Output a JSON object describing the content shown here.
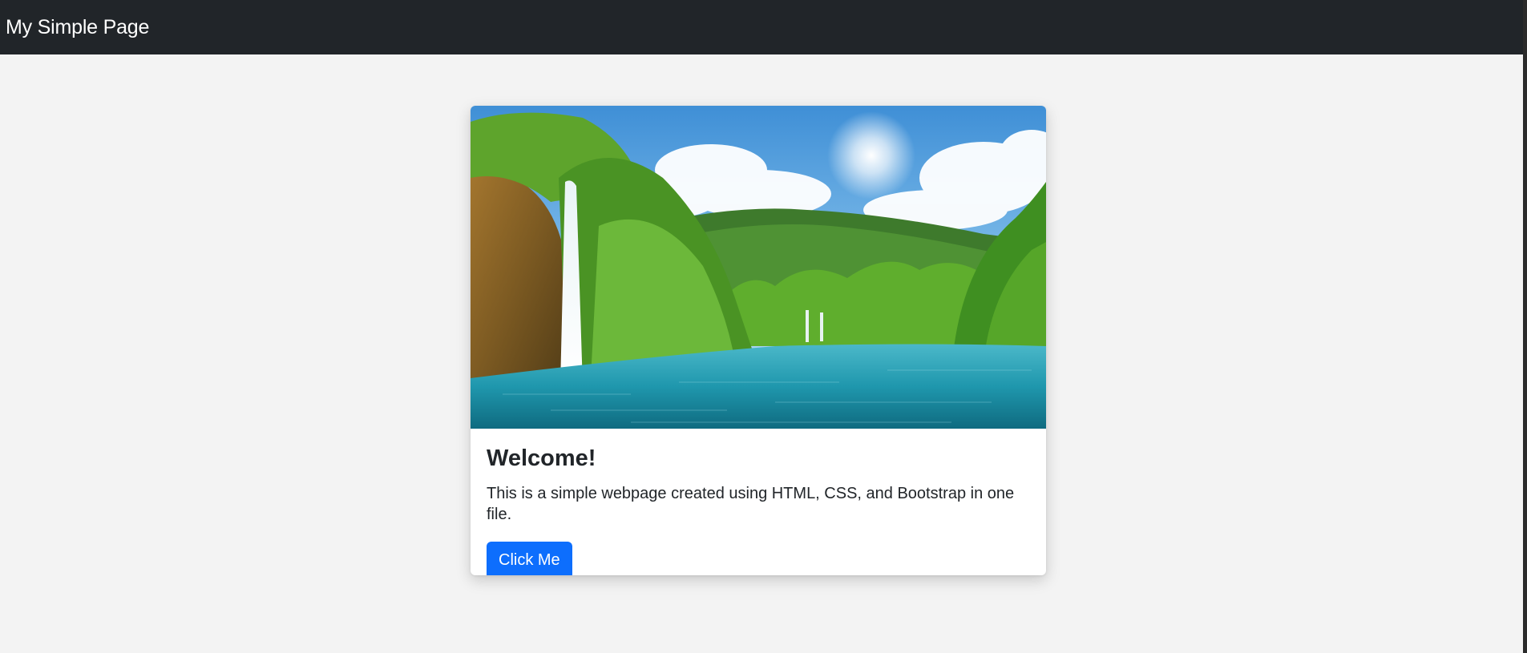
{
  "navbar": {
    "brand": "My Simple Page",
    "background_color": "#212529"
  },
  "card": {
    "image": {
      "description_icon": "waterfall-landscape-image"
    },
    "title": "Welcome!",
    "text": "This is a simple webpage created using HTML, CSS, and Bootstrap in one file.",
    "button_label": "Click Me",
    "button_color": "#0d6efd"
  },
  "page": {
    "background_color": "#f3f3f3"
  }
}
